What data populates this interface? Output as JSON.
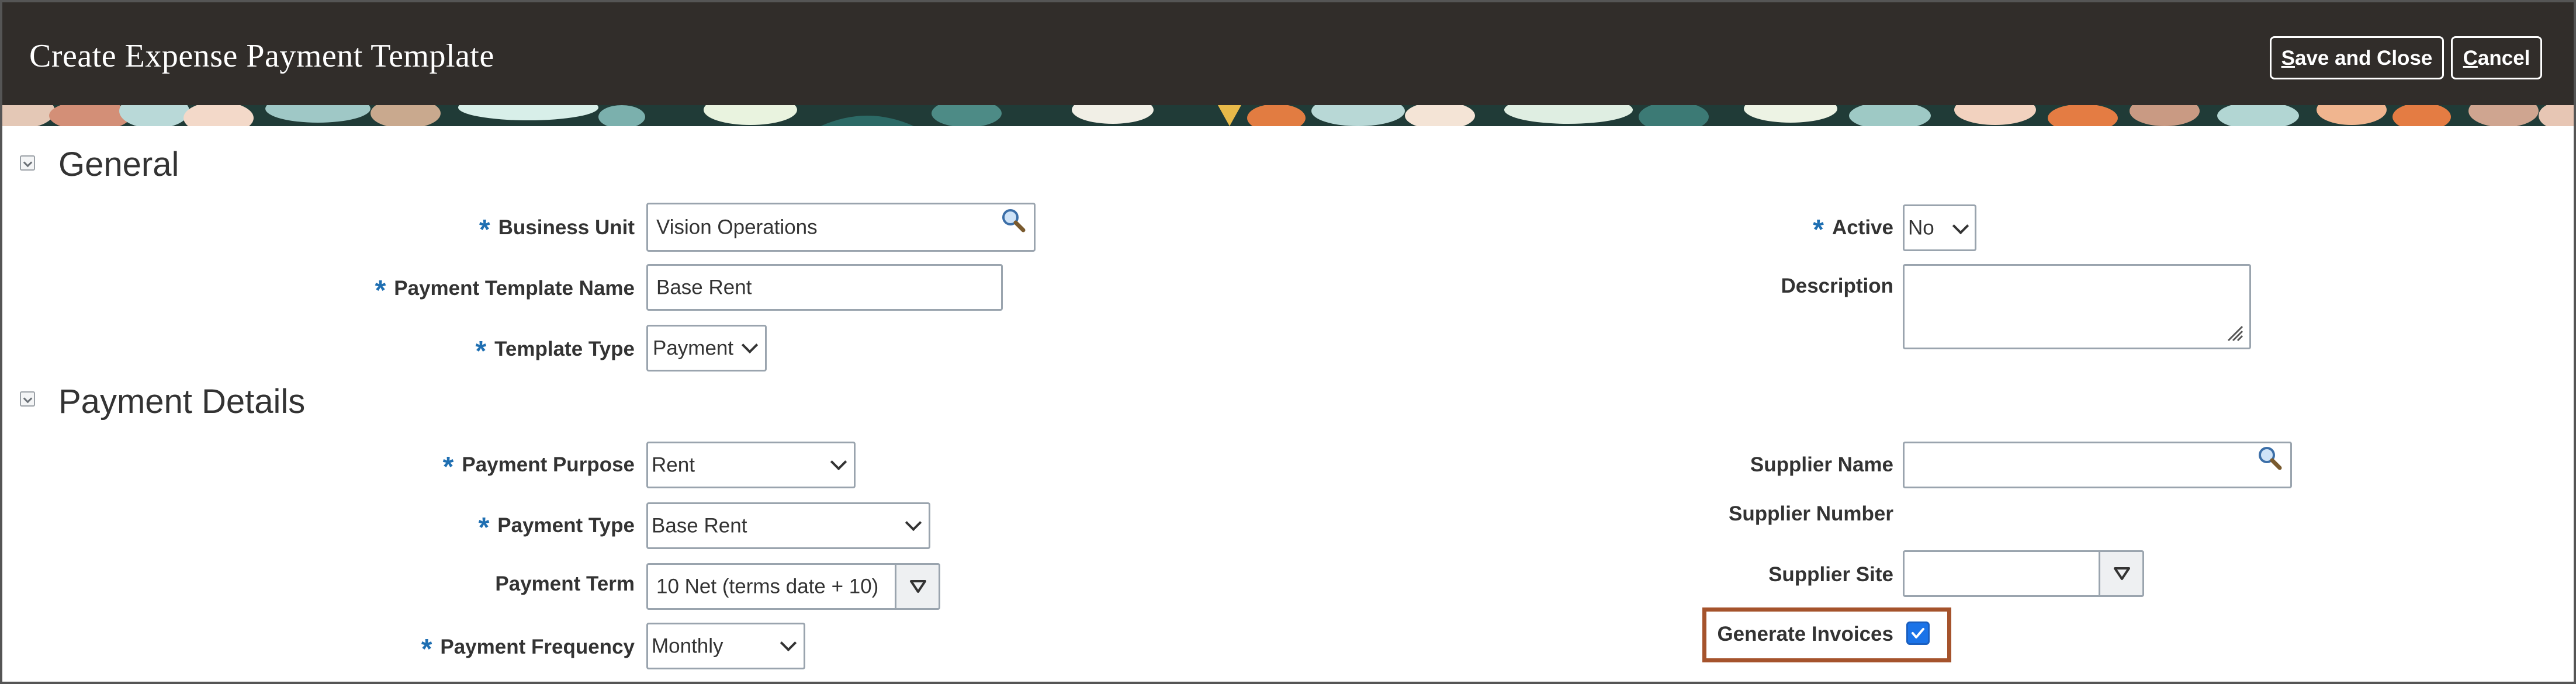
{
  "header": {
    "title": "Create Expense Payment Template",
    "save_close_first": "S",
    "save_close_rest": "ave and Close",
    "cancel_first": "C",
    "cancel_rest": "ancel"
  },
  "sections": {
    "general": {
      "title": "General"
    },
    "payment_details": {
      "title": "Payment Details"
    }
  },
  "general": {
    "business_unit": {
      "label": "Business Unit",
      "value": "Vision Operations",
      "required": true
    },
    "template_name": {
      "label": "Payment Template Name",
      "value": "Base Rent",
      "required": true
    },
    "template_type": {
      "label": "Template Type",
      "value": "Payment",
      "required": true
    },
    "active": {
      "label": "Active",
      "value": "No",
      "required": true
    },
    "description": {
      "label": "Description",
      "value": ""
    }
  },
  "payment_details": {
    "purpose": {
      "label": "Payment Purpose",
      "value": "Rent",
      "required": true
    },
    "type": {
      "label": "Payment Type",
      "value": "Base Rent",
      "required": true
    },
    "term": {
      "label": "Payment Term",
      "value": "10 Net (terms date + 10)"
    },
    "frequency": {
      "label": "Payment Frequency",
      "value": "Monthly",
      "required": true
    },
    "supplier_name": {
      "label": "Supplier Name",
      "value": ""
    },
    "supplier_number": {
      "label": "Supplier Number",
      "value": ""
    },
    "supplier_site": {
      "label": "Supplier Site",
      "value": ""
    },
    "generate_invoices": {
      "label": "Generate Invoices",
      "checked": true
    }
  },
  "required_marker": "*",
  "colors": {
    "header_bg": "#312d2a",
    "required_star": "#1f6fb2",
    "checkbox": "#1a73e8",
    "highlight_box": "#a5532c"
  },
  "icons": {
    "collapse": "chevron-down-icon",
    "lookup": "search-icon",
    "dropdown": "chevron-down-icon",
    "lov_dropdown": "triangle-down-icon",
    "resize": "resize-handle-icon",
    "check": "checkmark-icon"
  }
}
